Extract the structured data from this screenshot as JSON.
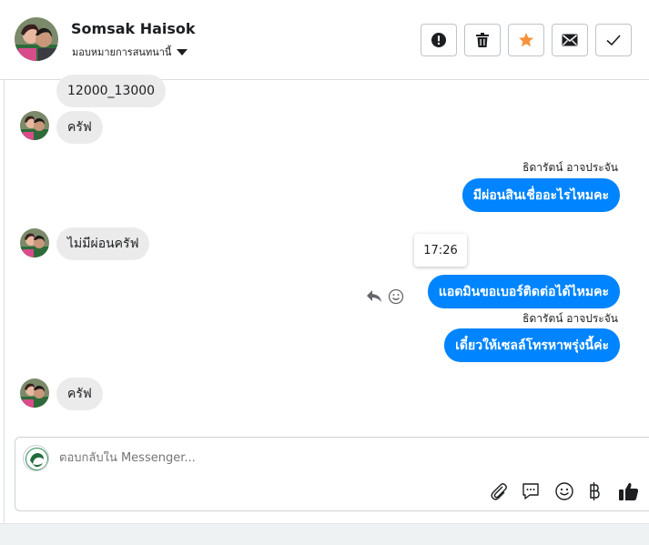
{
  "header": {
    "name": "Somsak Haisok",
    "assign_label": "มอบหมายการสนทนานี้"
  },
  "toolbar": {
    "spam_icon": "exclamation-icon",
    "delete_icon": "trash-icon",
    "star_icon": "star-icon",
    "unread_icon": "envelope-icon",
    "done_icon": "checkmark-icon",
    "star_color": "#f7923b"
  },
  "messages": [
    {
      "side": "in",
      "text": "12000_13000"
    },
    {
      "side": "in",
      "text": "ครัฟ"
    },
    {
      "side": "out",
      "sender": "ธิดารัตน์ อาจประจัน",
      "text": "มีผ่อนสินเชื่ออะไรไหมคะ"
    },
    {
      "side": "in",
      "text": "ไม่มีผ่อนครัฟ"
    },
    {
      "side": "out",
      "text": "แอดมินขอเบอร์ติดต่อได้ไหมคะ",
      "tooltip": "17:26"
    },
    {
      "side": "out",
      "sender": "ธิดารัตน์ อาจประจัน",
      "text": "เดี๋ยวให้เซลล์โทรหาพรุ่งนี้ค่ะ"
    },
    {
      "side": "in",
      "text": "ครัฟ"
    }
  ],
  "composer": {
    "placeholder": "ตอบกลับใน Messenger...",
    "icons": [
      "paperclip-icon",
      "speech-bubble-icon",
      "emoji-icon",
      "baht-icon",
      "thumbs-up-icon"
    ]
  },
  "colors": {
    "outgoing_bubble": "#0084ff",
    "incoming_bubble": "#ebebeb"
  }
}
